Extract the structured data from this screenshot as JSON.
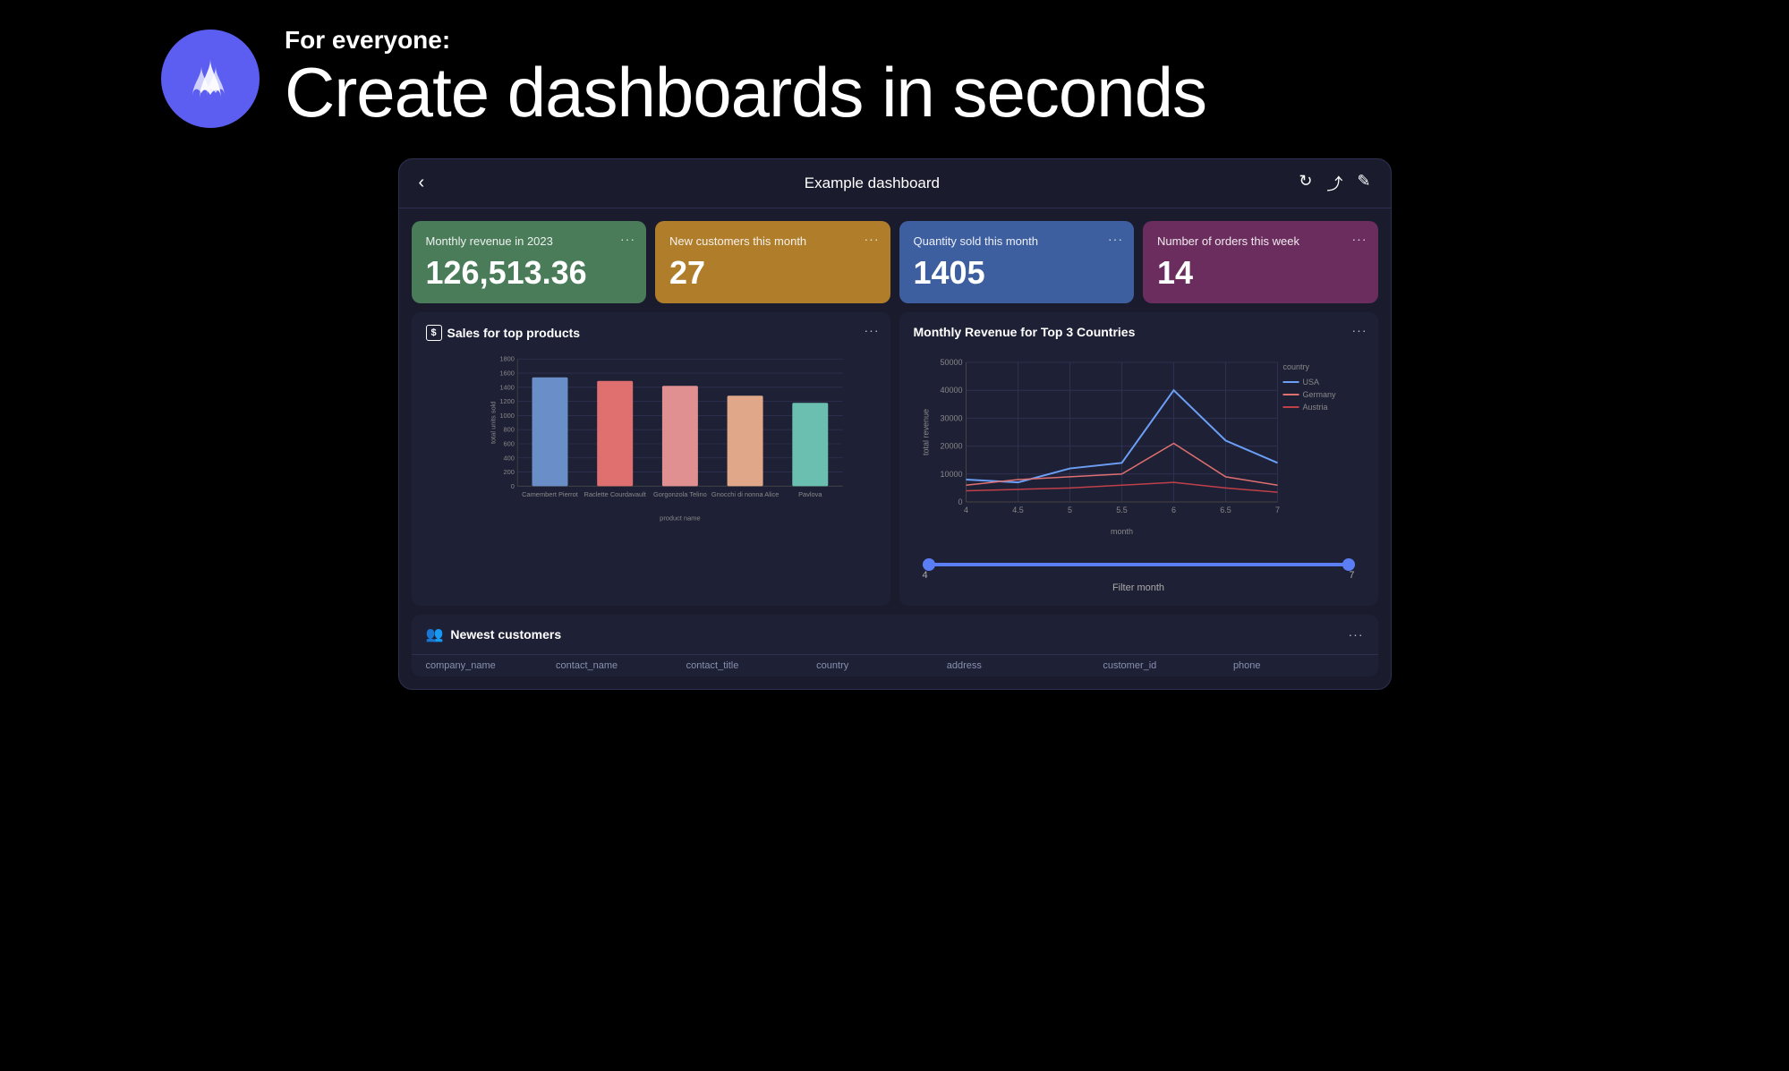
{
  "hero": {
    "subtitle": "For everyone:",
    "title": "Create dashboards in seconds"
  },
  "dashboard": {
    "title": "Example dashboard",
    "back_label": "‹",
    "icons": {
      "refresh": "↻",
      "share": "⤴",
      "edit": "✎"
    }
  },
  "kpi_cards": [
    {
      "id": "monthly-revenue",
      "label": "Monthly revenue in 2023",
      "value": "126,513.36",
      "color_class": "kpi-green",
      "menu": "···"
    },
    {
      "id": "new-customers",
      "label": "New customers this month",
      "value": "27",
      "color_class": "kpi-orange",
      "menu": "···"
    },
    {
      "id": "quantity-sold",
      "label": "Quantity sold this month",
      "value": "1405",
      "color_class": "kpi-blue",
      "menu": "···"
    },
    {
      "id": "orders-week",
      "label": "Number of orders this week",
      "value": "14",
      "color_class": "kpi-purple",
      "menu": "···"
    }
  ],
  "bar_chart": {
    "title": "Sales for top products",
    "menu": "···",
    "x_axis_label": "product name",
    "y_axis_label": "total units sold",
    "bars": [
      {
        "label": "Camembert Pierrot",
        "value": 1540,
        "color": "#6a8fc8"
      },
      {
        "label": "Raclette Courdavault",
        "value": 1490,
        "color": "#e07070"
      },
      {
        "label": "Gorgonzola Telino",
        "value": 1420,
        "color": "#e09090"
      },
      {
        "label": "Gnocchi di nonna Alice",
        "value": 1280,
        "color": "#e0a888"
      },
      {
        "label": "Pavlova",
        "value": 1180,
        "color": "#6abfb0"
      }
    ],
    "y_ticks": [
      0,
      200,
      400,
      600,
      800,
      1000,
      1200,
      1400,
      1600,
      1800
    ],
    "y_max": 1800
  },
  "line_chart": {
    "title": "Monthly Revenue for Top 3 Countries",
    "menu": "···",
    "x_axis_label": "month",
    "y_axis_label": "total revenue",
    "legend": {
      "title": "country",
      "items": [
        {
          "label": "USA",
          "color": "#6b9ef5"
        },
        {
          "label": "Germany",
          "color": "#e07070"
        },
        {
          "label": "Austria",
          "color": "#c0404a"
        }
      ]
    },
    "x_ticks": [
      4,
      4.5,
      5,
      5.5,
      6,
      6.5,
      7
    ],
    "y_ticks": [
      0,
      10000,
      20000,
      30000,
      40000,
      50000
    ],
    "series": {
      "USA": [
        {
          "x": 4,
          "y": 8000
        },
        {
          "x": 4.5,
          "y": 7000
        },
        {
          "x": 5,
          "y": 12000
        },
        {
          "x": 5.5,
          "y": 14000
        },
        {
          "x": 6,
          "y": 40000
        },
        {
          "x": 6.5,
          "y": 22000
        },
        {
          "x": 7,
          "y": 14000
        }
      ],
      "Germany": [
        {
          "x": 4,
          "y": 6000
        },
        {
          "x": 4.5,
          "y": 8000
        },
        {
          "x": 5,
          "y": 9000
        },
        {
          "x": 5.5,
          "y": 10000
        },
        {
          "x": 6,
          "y": 21000
        },
        {
          "x": 6.5,
          "y": 9000
        },
        {
          "x": 7,
          "y": 6000
        }
      ],
      "Austria": [
        {
          "x": 4,
          "y": 4000
        },
        {
          "x": 4.5,
          "y": 4500
        },
        {
          "x": 5,
          "y": 5000
        },
        {
          "x": 5.5,
          "y": 6000
        },
        {
          "x": 6,
          "y": 7000
        },
        {
          "x": 6.5,
          "y": 5000
        },
        {
          "x": 7,
          "y": 3500
        }
      ]
    },
    "filter_label": "Filter month",
    "filter_min": "4",
    "filter_max": "7"
  },
  "table": {
    "title": "Newest customers",
    "menu": "···",
    "columns": [
      "company_name",
      "contact_name",
      "contact_title",
      "country",
      "address",
      "customer_id",
      "phone"
    ]
  }
}
